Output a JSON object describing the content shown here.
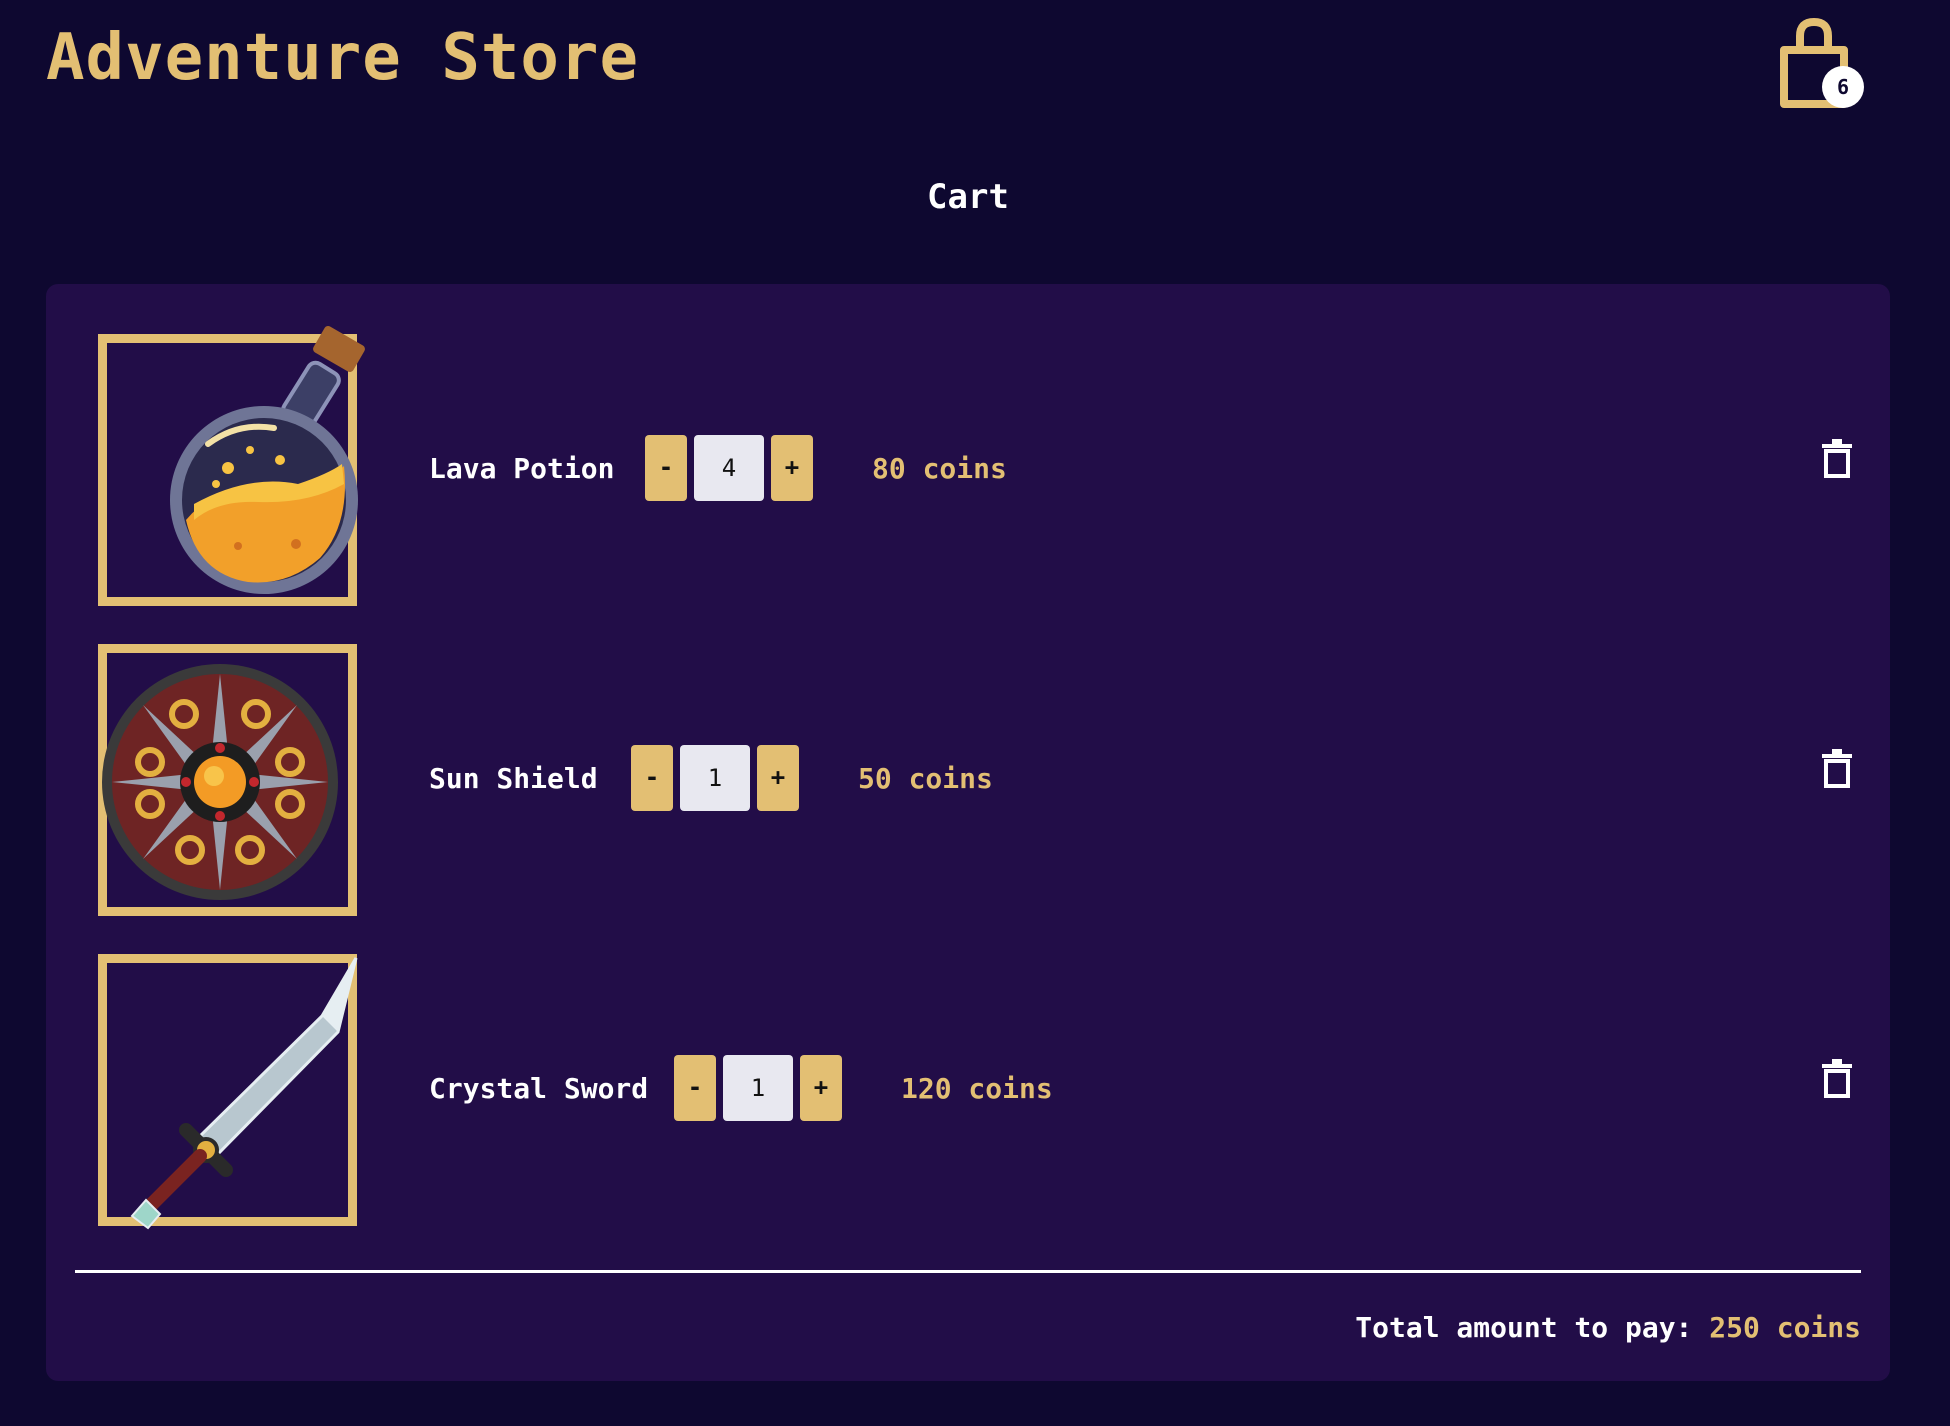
{
  "header": {
    "store_title": "Adventure Store",
    "cart_count": "6"
  },
  "page": {
    "heading": "Cart"
  },
  "cart": {
    "items": [
      {
        "name": "Lava Potion",
        "quantity": "4",
        "price": "80 coins",
        "minus": "-",
        "plus": "+",
        "icon": "lava-potion-icon"
      },
      {
        "name": "Sun Shield",
        "quantity": "1",
        "price": "50 coins",
        "minus": "-",
        "plus": "+",
        "icon": "sun-shield-icon"
      },
      {
        "name": "Crystal Sword",
        "quantity": "1",
        "price": "120 coins",
        "minus": "-",
        "plus": "+",
        "icon": "crystal-sword-icon"
      }
    ],
    "total_label": "Total amount to pay:",
    "total_amount": "250 coins"
  },
  "colors": {
    "background": "#0e0830",
    "panel": "#220d48",
    "accent_gold": "#e3bf73",
    "text": "#ffffff"
  }
}
